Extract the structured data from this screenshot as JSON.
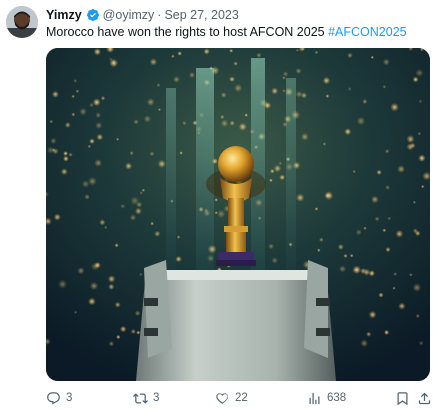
{
  "tweet": {
    "author_name": "Yimzy",
    "handle": "@oyimzy",
    "separator": "·",
    "date": "Sep 27, 2023",
    "text_plain": "Morocco have won the rights to host AFCON 2025 ",
    "hashtag": "#AFCON2025",
    "verified": true
  },
  "actions": {
    "replies": "3",
    "retweets": "3",
    "likes": "22",
    "views": "638"
  },
  "icons": {
    "reply": "reply-icon",
    "retweet": "retweet-icon",
    "like": "heart-icon",
    "views": "views-icon",
    "bookmark": "bookmark-icon",
    "share": "share-icon",
    "verified": "verified-badge-icon"
  },
  "colors": {
    "accent": "#1d9bf0",
    "secondary_text": "#536471",
    "primary_text": "#0f1419"
  }
}
